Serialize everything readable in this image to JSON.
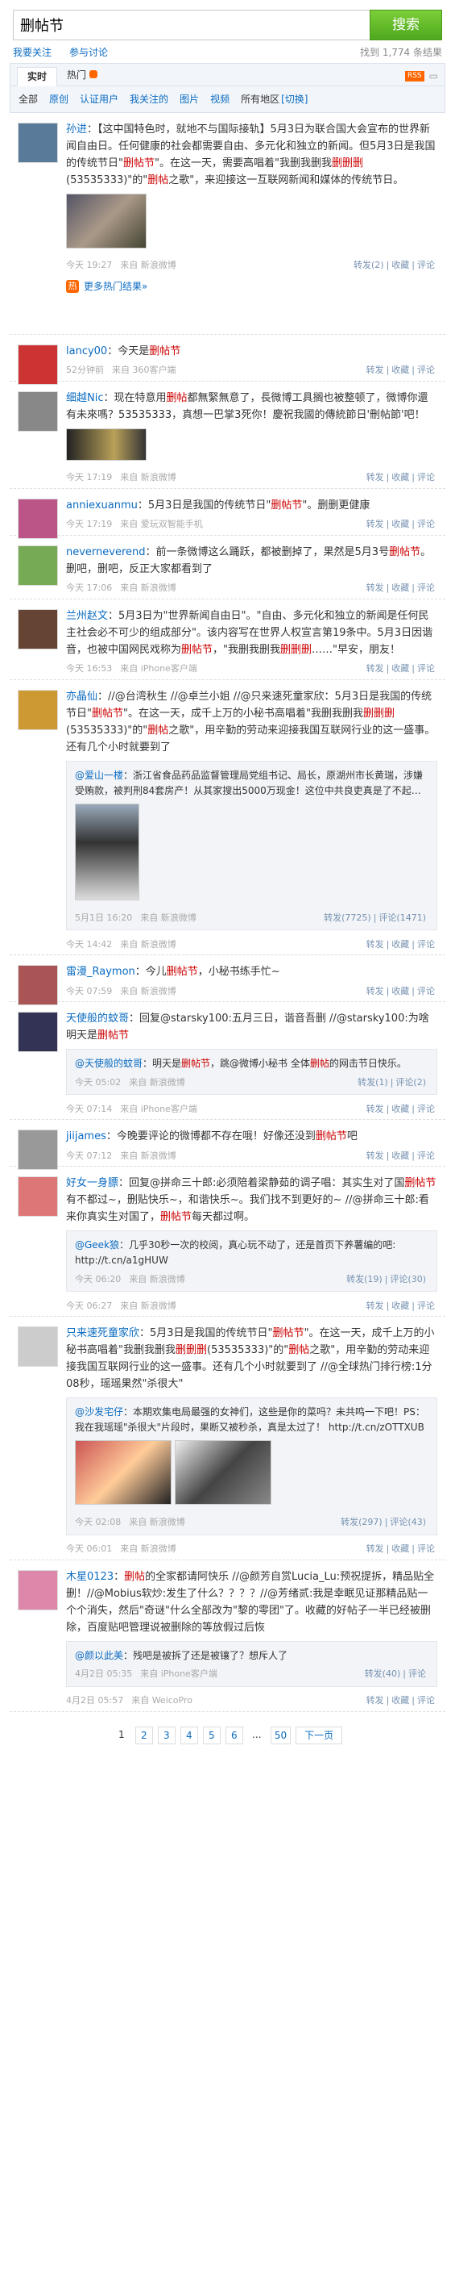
{
  "search": {
    "query": "删帖节",
    "button": "搜索"
  },
  "links": [
    "我要关注",
    "参与讨论"
  ],
  "result_count": "找到 1,774 条结果",
  "tabs": [
    "实时",
    "热门"
  ],
  "types": [
    "全部",
    "原创",
    "认证用户",
    "我关注的",
    "图片",
    "视频",
    "所有地区",
    "[切换]"
  ],
  "feed": [
    {
      "name": "孙进",
      "text": "：【这中国特色时，就地不与国际接轨】5月3日为联合国大会宣布的世界新闻自由日。任何健康的社会都需要自由、多元化和独立的新闻。但5月3日是我国的传统节日\"删帖节\"。在这一天，需要高唱着\"我删我删我删删删(53535333)\"的\"删帖之歌\"，来迎接这一互联网新闻和媒体的传统节日。",
      "time": "今天 19:27",
      "src": "来自 新浪微博",
      "actions": [
        "转发(2)",
        "收藏",
        "评论"
      ],
      "hot": "更多热门结果»"
    },
    {
      "name": "lancy00",
      "text": "：今天是删帖节",
      "time": "52分钟前",
      "src": "来自 360客户端",
      "actions": [
        "转发",
        "收藏",
        "评论"
      ]
    },
    {
      "name": "细越Nic",
      "text": "：现在特意用删帖都無緊無意了，長微博工具搁也被整顿了，微博你還有未來嗎？53535333，真想一巴掌3死你！慶祝我國的傳統節日'刪帖節'吧！",
      "time": "今天 17:19",
      "src": "来自 新浪微博",
      "actions": [
        "转发",
        "收藏",
        "评论"
      ]
    },
    {
      "name": "anniexuanmu",
      "text": "：5月3日是我国的传统节日\"删帖节\"。删删更健康",
      "time": "今天 17:19",
      "src": "来自 爱玩双智能手机",
      "actions": [
        "转发",
        "收藏",
        "评论"
      ]
    },
    {
      "name": "neverneverend",
      "text": "：前一条微博这么踊跃，都被删掉了，果然是5月3号删帖节。删吧，删吧，反正大家都看到了",
      "time": "今天 17:06",
      "src": "来自 新浪微博",
      "actions": [
        "转发",
        "收藏",
        "评论"
      ]
    },
    {
      "name": "兰州赵文",
      "text": "：5月3日为\"世界新闻自由日\"。\"自由、多元化和独立的新闻是任何民主社会必不可少的组成部分\"。该内容写在世界人权宣言第19条中。5月3日因谐音，也被中国网民戏称为删帖节，\"我删我删我删删删……\"早安，朋友！",
      "time": "今天 16:53",
      "src": "来自 iPhone客户端",
      "actions": [
        "转发",
        "收藏",
        "评论"
      ]
    },
    {
      "name": "亦晶仙",
      "text": "：//@台湾秋生 //@卓兰小姐 //@只来速死童家欣：5月3日是我国的传统节日\"删帖节\"。在这一天，成千上万的小秘书高唱着\"我删我删我删删删(53535333)\"的\"删帖之歌\"，用辛勤的劳动来迎接我国互联网行业的这一盛事。还有几个小时就要到了",
      "fwd_name": "@爱山一楼",
      "fwd_text": "：浙江省食品药品监督管理局党组书记、局长，原湖州市长黄瑞，涉嫌受贿款，被判刑84套房产！从其家搜出5000万现金！这位中共良吏真是了不起…",
      "fwd_time": "5月1日 16:20",
      "fwd_src": "来自 新浪微博",
      "fwd_actions": [
        "转发(7725)",
        "评论(1471)"
      ],
      "time": "今天 14:42",
      "src": "来自 新浪微博",
      "actions": [
        "转发",
        "收藏",
        "评论"
      ]
    },
    {
      "name": "雷漫_Raymon",
      "text": "：今儿删帖节，小秘书练手忙~",
      "time": "今天 07:59",
      "src": "来自 新浪微博",
      "actions": [
        "转发",
        "收藏",
        "评论"
      ]
    },
    {
      "name": "天使般的蚊哥",
      "text": "：回复@starsky100:五月三日，谐音吾删 //@starsky100:为啥明天是删帖节",
      "fwd_name": "@天使般的蚊哥",
      "fwd_text": "：明天是删帖节，跳@微博小秘书 全体删帖的网击节日快乐。",
      "fwd_time": "今天 05:02",
      "fwd_src": "来自 新浪微博",
      "fwd_actions": [
        "转发(1)",
        "评论(2)"
      ],
      "time": "今天 07:14",
      "src": "来自 iPhone客户端",
      "actions": [
        "转发",
        "收藏",
        "评论"
      ]
    },
    {
      "name": "jiijames",
      "text": "：今晚要评论的微博都不存在哦！好像还没到删帖节吧",
      "time": "今天 07:12",
      "src": "来自 新浪微博",
      "actions": [
        "转发",
        "收藏",
        "评论"
      ]
    },
    {
      "name": "好女一身膘",
      "text": "：回复@拼命三十郎:必须陪着梁静茹的调子唱：其实生对了国删帖节有不都过~，删贴快乐~，和谐快乐~。我们找不到更好的~ //@拼命三十郎:看来你真实生对国了，删帖节每天都过啊。",
      "fwd_name": "@Geek狼",
      "fwd_text": "：几乎30秒一次的校阅，真心玩不动了，还是首页下养薯编的吧: http://t.cn/a1gHUW",
      "fwd_time": "今天 06:20",
      "fwd_src": "来自 新浪微博",
      "fwd_actions": [
        "转发(19)",
        "评论(30)"
      ],
      "time": "今天 06:27",
      "src": "来自 新浪微博",
      "actions": [
        "转发",
        "收藏",
        "评论"
      ]
    },
    {
      "name": "只来速死童家欣",
      "text": "：5月3日是我国的传统节日\"删帖节\"。在这一天，成千上万的小秘书高唱着\"我删我删我删删删(53535333)\"的\"删帖之歌\"，用辛勤的劳动来迎接我国互联网行业的这一盛事。还有几个小时就要到了 //@全球热门排行榜:1分08秒，瑶瑶果然\"杀很大\"",
      "fwd_name": "@沙发宅仔",
      "fwd_text": "：本期欢集电局最强的女神们，这些是你的菜吗？未共鸣一下吧！PS：我在我瑶瑶\"杀很大\"片段时，果断又被秒杀，真是太过了！ http://t.cn/zOTTXUB",
      "fwd_time": "今天 02:08",
      "fwd_src": "来自 新浪微博",
      "fwd_actions": [
        "转发(297)",
        "评论(43)"
      ],
      "time": "今天 06:01",
      "src": "来自 新浪微博",
      "actions": [
        "转发",
        "收藏",
        "评论"
      ]
    },
    {
      "name": "木星0123",
      "text": "：删帖的全家都请阿快乐 //@颜芳自赏Lucia_Lu:预祝提拆，精品贴全删！//@Mobius软炒:发生了什么？？？？//@芳绪贰:我是幸眠见证那精品贴一个个消失，然后\"奇谜\"什么全部改为\"黎的零团\"了。收藏的好帖子一半已经被删除，百度贴吧管理说被删除的等放假过后恢",
      "fwd_name": "@颜以此美",
      "fwd_text": "：残吧是被拆了还是被镶了？想斥人了",
      "fwd_time": "4月2日 05:35",
      "fwd_src": "来自 iPhone客户端",
      "fwd_actions": [
        "转发(40)",
        "评论"
      ],
      "time": "4月2日 05:57",
      "src": "来自 WeicoPro",
      "actions": [
        "转发",
        "收藏",
        "评论"
      ]
    }
  ],
  "pager": {
    "pages": [
      "1",
      "2",
      "3",
      "4",
      "5",
      "6",
      "...",
      "50"
    ],
    "next": "下一页"
  },
  "colors": {
    "accent": "#0b6bc1",
    "keyword": "#c00",
    "search_green": "#6cc02c"
  }
}
